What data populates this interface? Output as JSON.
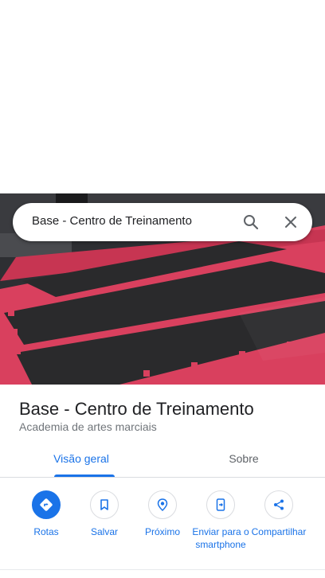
{
  "search": {
    "query": "Base - Centro de Treinamento"
  },
  "place": {
    "name": "Base - Centro de Treinamento",
    "category": "Academia de artes marciais"
  },
  "tabs": [
    {
      "label": "Visão geral",
      "active": true
    },
    {
      "label": "Sobre",
      "active": false
    }
  ],
  "actions": [
    {
      "label": "Rotas",
      "icon": "directions-icon"
    },
    {
      "label": "Salvar",
      "icon": "bookmark-icon"
    },
    {
      "label": "Próximo",
      "icon": "nearby-icon"
    },
    {
      "label": "Enviar para o smartphone",
      "icon": "send-to-phone-icon"
    },
    {
      "label": "Compartilhar",
      "icon": "share-icon"
    }
  ],
  "colors": {
    "accent": "#1a73e8",
    "mat_red": "#d9405e",
    "mat_black": "#2a2a2c"
  }
}
